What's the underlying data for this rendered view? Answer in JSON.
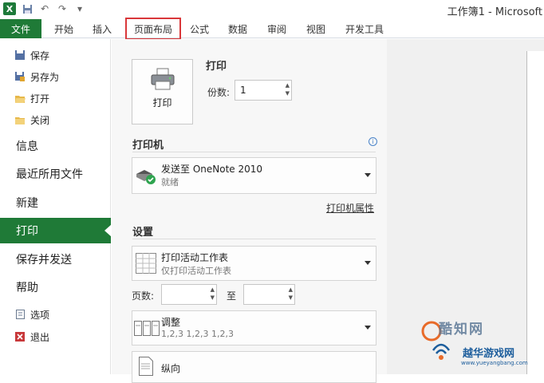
{
  "window": {
    "title": "工作簿1 - Microsoft"
  },
  "quick_access": {
    "icons": [
      "excel-logo",
      "save-icon",
      "undo-icon",
      "redo-icon",
      "customize-icon"
    ],
    "excel_glyph": "X"
  },
  "ribbon": {
    "file_tab": "文件",
    "tabs": [
      "开始",
      "插入",
      "页面布局",
      "公式",
      "数据",
      "审阅",
      "视图",
      "开发工具"
    ],
    "highlighted_tab": "页面布局"
  },
  "nav": {
    "small_top": [
      {
        "label": "保存",
        "icon": "save-icon"
      },
      {
        "label": "另存为",
        "icon": "save-as-icon"
      },
      {
        "label": "打开",
        "icon": "open-folder-icon"
      },
      {
        "label": "关闭",
        "icon": "close-folder-icon"
      }
    ],
    "large": [
      "信息",
      "最近所用文件",
      "新建",
      "打印",
      "保存并发送",
      "帮助"
    ],
    "active": "打印",
    "small_bottom": [
      {
        "label": "选项",
        "icon": "options-icon"
      },
      {
        "label": "退出",
        "icon": "exit-icon"
      }
    ]
  },
  "print": {
    "button_label": "打印",
    "section_title": "打印",
    "copies_label": "份数:",
    "copies_value": "1",
    "printer_heading": "打印机",
    "printer_name": "发送至 OneNote 2010",
    "printer_status": "就绪",
    "printer_properties_link": "打印机属性",
    "settings_heading": "设置",
    "what_to_print": "打印活动工作表",
    "what_to_print_desc": "仅打印活动工作表",
    "pages_label": "页数:",
    "pages_from": "",
    "pages_to_label": "至",
    "pages_to": "",
    "collate_title": "调整",
    "collate_desc": "1,2,3    1,2,3    1,2,3",
    "orientation": "纵向"
  },
  "watermark": {
    "brand": "酷知网",
    "site_name": "越华游戏网",
    "site_url": "www.yueyangbang.com"
  },
  "colors": {
    "file_green": "#1f7a37",
    "highlight_red": "#d9373a",
    "link_blue": "#1c5d9c"
  }
}
